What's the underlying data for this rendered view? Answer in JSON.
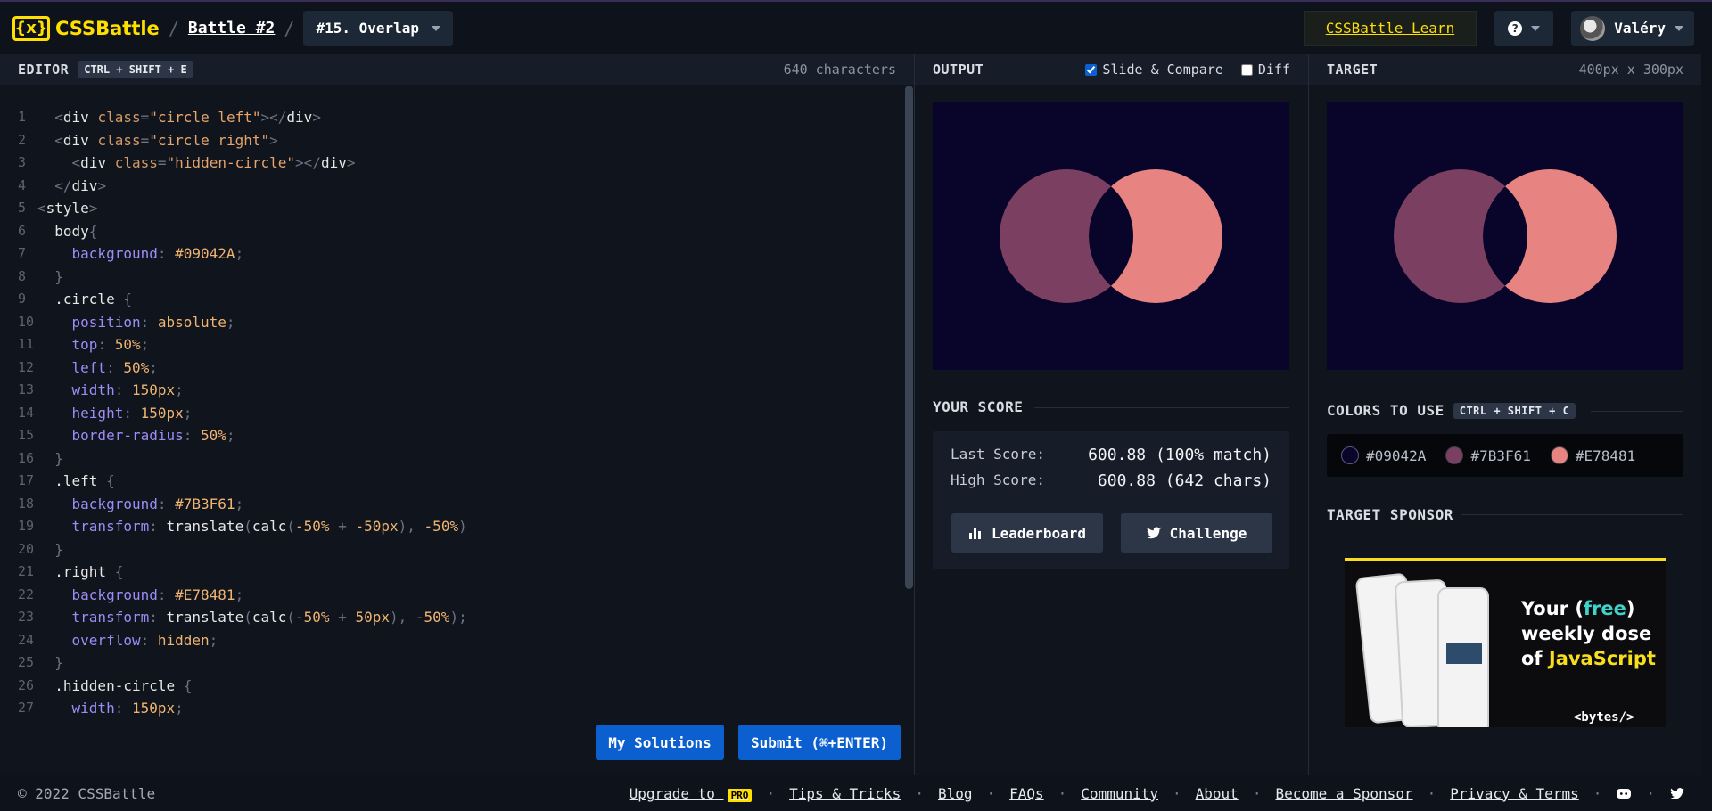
{
  "header": {
    "logo_text": "CSSBattle",
    "logo_mark": "{x}",
    "battle_link": "Battle #2",
    "target_select": "#15. Overlap",
    "learn_label": "CSSBattle Learn",
    "help_glyph": "?",
    "user_name": "Valéry"
  },
  "editor": {
    "title": "EDITOR",
    "shortcut": "CTRL + SHIFT + E",
    "char_count": "640 characters",
    "my_solutions": "My Solutions",
    "submit": "Submit (⌘+ENTER)",
    "lines": [
      "1",
      "2",
      "3",
      "4",
      "5",
      "6",
      "7",
      "8",
      "9",
      "10",
      "11",
      "12",
      "13",
      "14",
      "15",
      "16",
      "17",
      "18",
      "19",
      "20",
      "21",
      "22",
      "23",
      "24",
      "25",
      "26",
      "27"
    ]
  },
  "output": {
    "title": "OUTPUT",
    "slide_compare": "Slide & Compare",
    "slide_compare_checked": true,
    "diff": "Diff",
    "diff_checked": false
  },
  "target": {
    "title": "TARGET",
    "size": "400px x 300px"
  },
  "score": {
    "title": "YOUR SCORE",
    "last_label": "Last Score:",
    "last_value": "600.88 (100% match)",
    "high_label": "High Score:",
    "high_value": "600.88 (642 chars)",
    "leaderboard": "Leaderboard",
    "challenge": "Challenge"
  },
  "colors": {
    "title": "COLORS TO USE",
    "shortcut": "CTRL + SHIFT + C",
    "items": [
      {
        "label": "#09042A",
        "hex": "#09042A"
      },
      {
        "label": "#7B3F61",
        "hex": "#7B3F61"
      },
      {
        "label": "#E78481",
        "hex": "#E78481"
      }
    ]
  },
  "sponsor": {
    "title": "TARGET SPONSOR",
    "line1_a": "Your (",
    "line1_free": "free",
    "line1_b": ")",
    "line2": "weekly dose",
    "line3_a": "of ",
    "line3_js": "JavaScript",
    "brand": "<bytes/>"
  },
  "footer": {
    "copyright": "© 2022 CSSBattle",
    "upgrade": "Upgrade to",
    "pro_badge": "PRO",
    "tips": "Tips & Tricks",
    "blog": "Blog",
    "faqs": "FAQs",
    "community": "Community",
    "about": "About",
    "sponsor": "Become a Sponsor",
    "privacy": "Privacy & Terms"
  },
  "theme": {
    "accent_yellow": "#ffdf00",
    "primary_blue": "#0b5fcf",
    "bg": "#09042A",
    "left_circle": "#7B3F61",
    "right_circle": "#E78481"
  }
}
